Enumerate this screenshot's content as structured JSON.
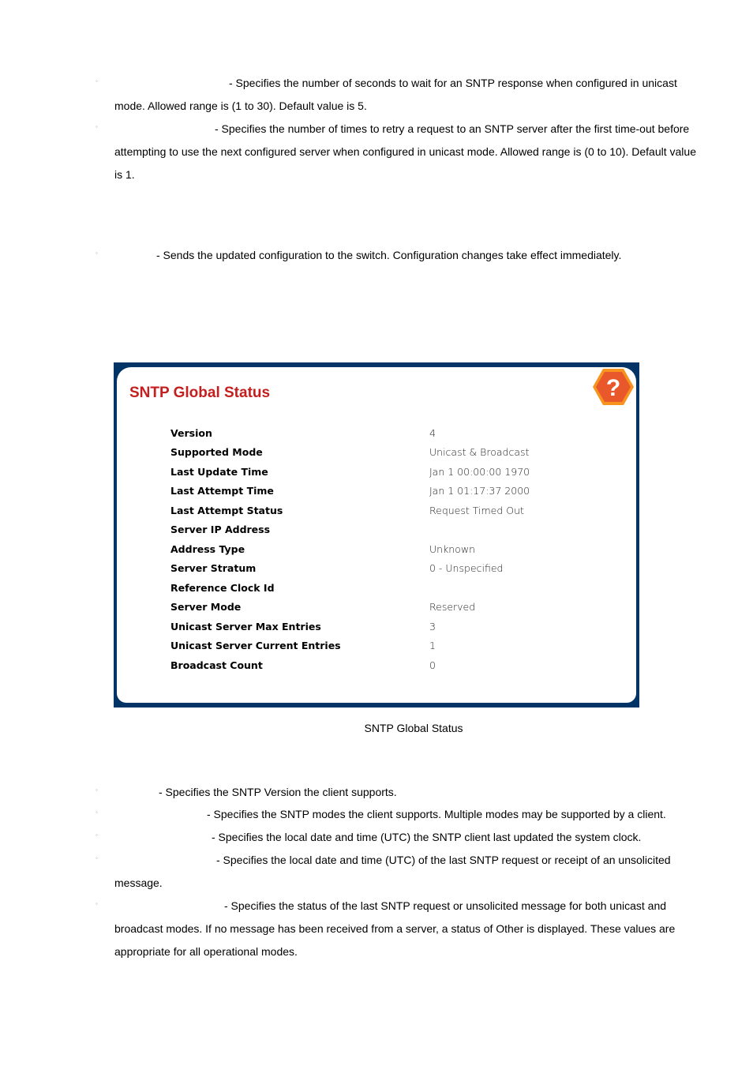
{
  "top_section": {
    "items": [
      {
        "bullet": "◦",
        "text": "- Specifies the number of seconds to wait for an SNTP response when configured in unicast mode. Allowed range is (1 to 30). Default value is 5."
      },
      {
        "bullet": "◦",
        "text": "- Specifies the number of times to retry a request to an SNTP server after the first time-out before attempting to use the next configured server when configured in unicast mode. Allowed range is (0 to 10). Default value is 1."
      }
    ],
    "submit": {
      "bullet": "◦",
      "text": "- Sends the updated configuration to the switch. Configuration changes take effect immediately."
    }
  },
  "panel": {
    "title": "SNTP Global Status",
    "help_icon": "question-mark-hexagon-icon",
    "colors": {
      "border": "#003466",
      "title": "#c41e1e",
      "help_fill": "#e8582a",
      "help_ring": "#f7931e"
    },
    "rows": [
      {
        "label": "Version",
        "value": "4"
      },
      {
        "label": "Supported Mode",
        "value": "Unicast & Broadcast"
      },
      {
        "label": "Last Update Time",
        "value": "Jan 1 00:00:00 1970"
      },
      {
        "label": "Last Attempt Time",
        "value": "Jan 1 01:17:37 2000"
      },
      {
        "label": "Last Attempt Status",
        "value": "Request Timed Out"
      },
      {
        "label": "Server IP Address",
        "value": ""
      },
      {
        "label": "Address Type",
        "value": "Unknown"
      },
      {
        "label": "Server Stratum",
        "value": "0 - Unspecified"
      },
      {
        "label": "Reference Clock Id",
        "value": ""
      },
      {
        "label": "Server Mode",
        "value": "Reserved"
      },
      {
        "label": "Unicast Server Max Entries",
        "value": "3"
      },
      {
        "label": "Unicast Server Current Entries",
        "value": "1"
      },
      {
        "label": "Broadcast Count",
        "value": "0"
      }
    ]
  },
  "caption": "SNTP Global Status",
  "bottom_section": {
    "items": [
      {
        "bullet": "◦",
        "text": "- Specifies the SNTP Version the client supports."
      },
      {
        "bullet": "◦",
        "text": "- Specifies the SNTP modes the client supports. Multiple modes may be supported by a client."
      },
      {
        "bullet": "◦",
        "text": "- Specifies the local date and time (UTC) the SNTP client last updated the system clock."
      },
      {
        "bullet": "◦",
        "text": "- Specifies the local date and time (UTC) of the last SNTP request or receipt of an unsolicited message."
      },
      {
        "bullet": "◦",
        "text": "- Specifies the status of the last SNTP request or unsolicited message for both unicast and broadcast modes. If no message has been received from a server, a status of Other is displayed. These values are appropriate for all operational modes."
      }
    ]
  }
}
